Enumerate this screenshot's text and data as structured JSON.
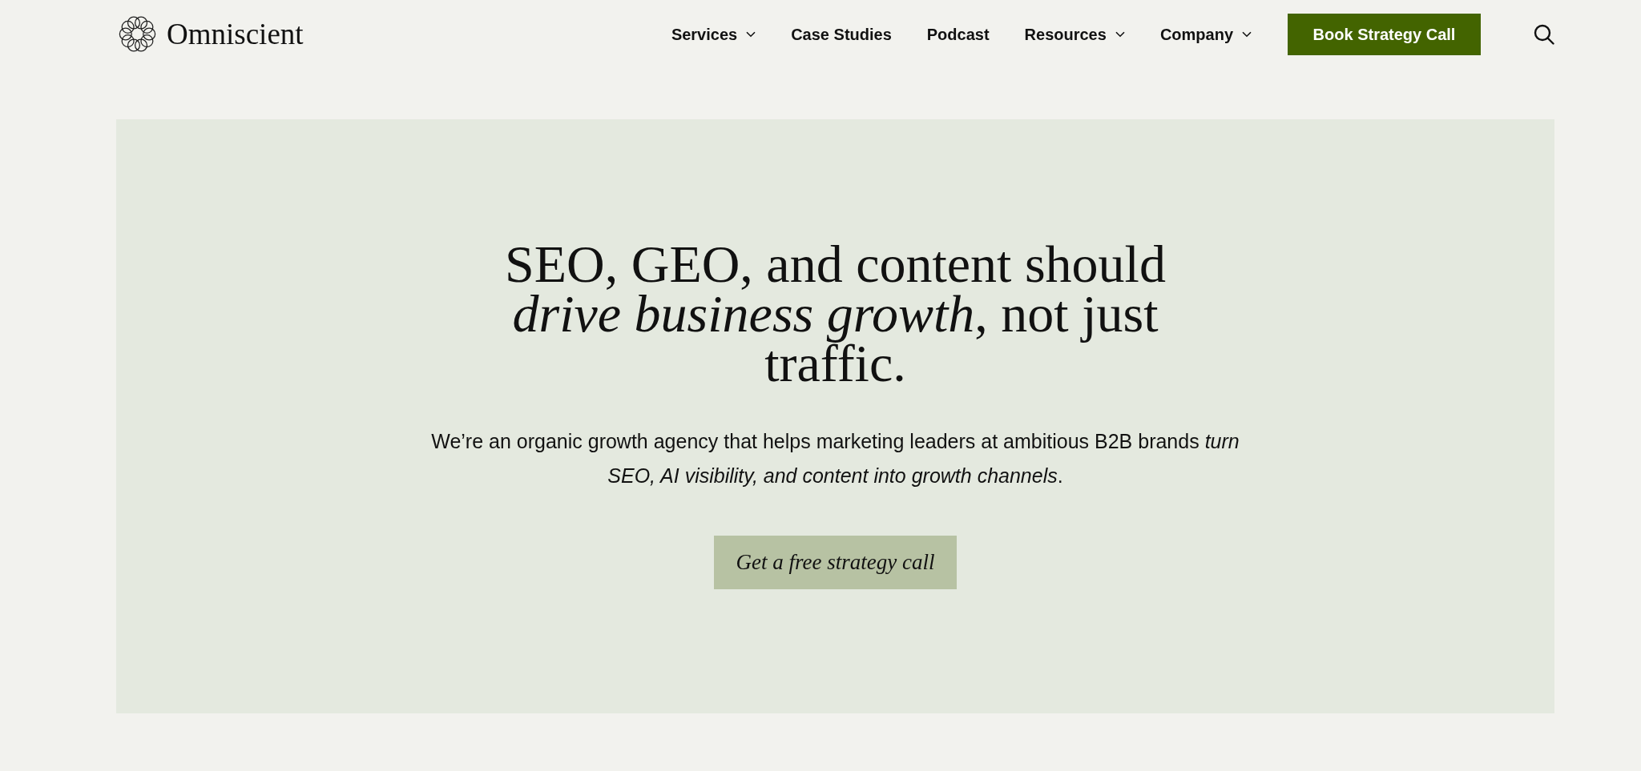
{
  "header": {
    "logo": {
      "name": "Omniscient"
    },
    "nav": [
      {
        "label": "Services",
        "dropdown": true
      },
      {
        "label": "Case Studies",
        "dropdown": false
      },
      {
        "label": "Podcast",
        "dropdown": false
      },
      {
        "label": "Resources",
        "dropdown": true
      },
      {
        "label": "Company",
        "dropdown": true
      }
    ],
    "cta": "Book Strategy Call"
  },
  "hero": {
    "heading": "SEO, GEO, and content should *drive business growth*, not just traffic.",
    "subheading": "We’re an organic growth agency that helps marketing leaders at ambitious B2B brands *turn SEO, AI visibility, and content into growth channels*.",
    "button": "Get a free strategy call"
  }
}
